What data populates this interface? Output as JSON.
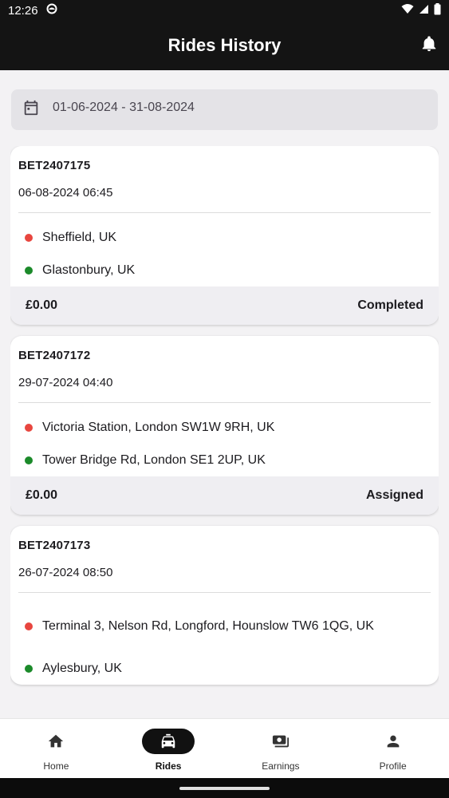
{
  "status_bar": {
    "time": "12:26"
  },
  "header": {
    "title": "Rides History"
  },
  "date_filter": {
    "range": "01-06-2024 - 31-08-2024"
  },
  "rides": [
    {
      "id": "BET2407175",
      "datetime": "06-08-2024 06:45",
      "pickup": "Sheffield, UK",
      "dropoff": "Glastonbury, UK",
      "fare": "£0.00",
      "status": "Completed"
    },
    {
      "id": "BET2407172",
      "datetime": "29-07-2024 04:40",
      "pickup": "Victoria Station, London SW1W 9RH, UK",
      "dropoff": "Tower Bridge Rd, London SE1 2UP, UK",
      "fare": "£0.00",
      "status": "Assigned"
    },
    {
      "id": "BET2407173",
      "datetime": "26-07-2024 08:50",
      "pickup": "Terminal 3, Nelson Rd, Longford, Hounslow TW6 1QG, UK",
      "dropoff": "Aylesbury, UK"
    }
  ],
  "bottom_nav": {
    "items": [
      {
        "label": "Home",
        "icon": "home-icon"
      },
      {
        "label": "Rides",
        "icon": "taxi-icon",
        "active": true
      },
      {
        "label": "Earnings",
        "icon": "earnings-icon"
      },
      {
        "label": "Profile",
        "icon": "profile-icon"
      }
    ]
  },
  "colors": {
    "app_bar": "#141414",
    "pickup_dot": "#e8463f",
    "dropoff_dot": "#1b8a2a",
    "background": "#f3f2f4"
  }
}
